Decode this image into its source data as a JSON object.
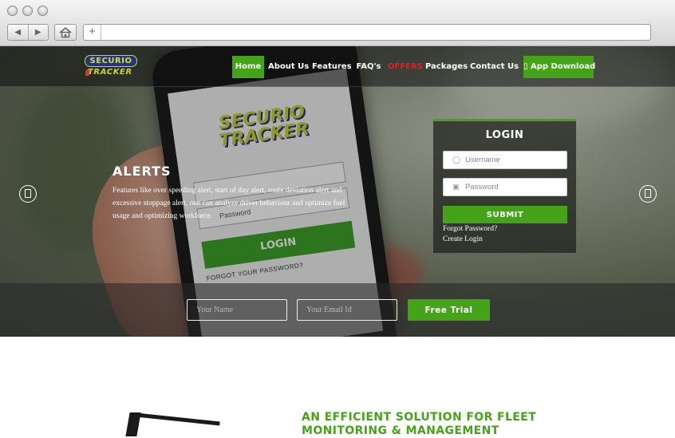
{
  "browser": {
    "back_icon": "back-arrow-icon",
    "forward_icon": "forward-arrow-icon",
    "home_icon": "home-icon",
    "new_tab_symbol": "+",
    "address_value": ""
  },
  "brand": {
    "line1": "SECURIO",
    "line2": "TRACKER"
  },
  "nav": {
    "items": [
      "Home",
      "About Us",
      "Features",
      "FAQ's",
      "OFFERS",
      "Packages",
      "Contact Us"
    ],
    "download": "▯ App Download"
  },
  "slide": {
    "title": "ALERTS",
    "text": "Features like over speeding alert, start of day alert, route deviation alert and excessive stoppage alert, one can analyze driver behaviour and optimize fuel usage and optimizing workforce."
  },
  "phone_screen": {
    "logo_line1": "SECURIO",
    "logo_line2": "TRACKER",
    "password_label": "Password",
    "login_button": "LOGIN",
    "forgot": "FORGOT YOUR PASSWORD?"
  },
  "login": {
    "title": "LOGIN",
    "username_placeholder": "Username",
    "password_placeholder": "Password",
    "submit": "SUBMIT",
    "forgot": "Forgot Password?",
    "create": "Create Login"
  },
  "trial": {
    "name_placeholder": "Your Name",
    "email_placeholder": "Your Email Id",
    "button": "Free Trial"
  },
  "section": {
    "headline": "AN EFFICIENT SOLUTION FOR FLEET MONITORING & MANAGEMENT"
  },
  "colors": {
    "accent_green": "#45a319",
    "offers_red": "#e0211b",
    "brand_yellow": "#c8d534",
    "brand_blue": "#27337e"
  }
}
